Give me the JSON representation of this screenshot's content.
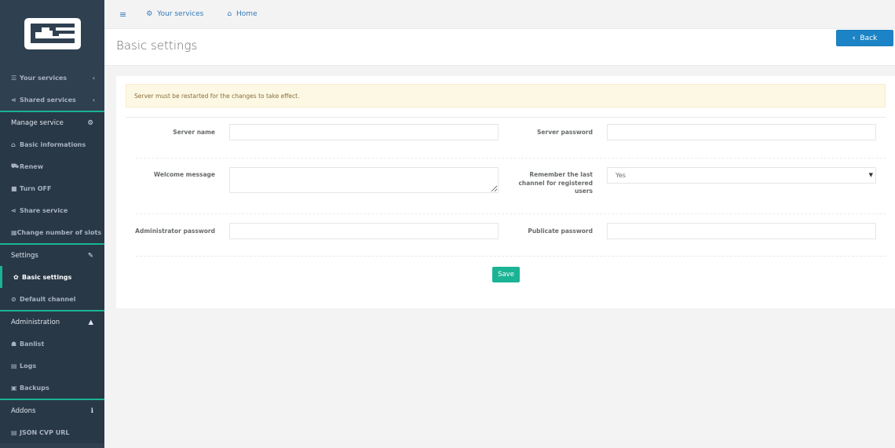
{
  "sidebar": {
    "logo": "logo",
    "items": [
      {
        "icon": "list-icon",
        "label": "Your services",
        "arrow": "‹"
      },
      {
        "icon": "share-icon",
        "label": "Shared services",
        "arrow": "‹"
      }
    ],
    "manage": {
      "title": "Manage service",
      "icon": "cogs-icon",
      "items": [
        {
          "icon": "home-icon",
          "label": "Basic informations"
        },
        {
          "icon": "cart-icon",
          "label": "Renew"
        },
        {
          "icon": "stop-icon",
          "label": "Turn OFF"
        },
        {
          "icon": "share-icon",
          "label": "Share service"
        },
        {
          "icon": "grid-icon",
          "label": "Change number of slots"
        }
      ]
    },
    "settings": {
      "title": "Settings",
      "icon": "wrench-icon",
      "items": [
        {
          "icon": "gear-icon",
          "label": "Basic settings",
          "active": true
        },
        {
          "icon": "circle-check-icon",
          "label": "Default channel"
        }
      ]
    },
    "administration": {
      "title": "Administration",
      "icon": "warning-icon",
      "items": [
        {
          "icon": "user-ban-icon",
          "label": "Banlist"
        },
        {
          "icon": "file-icon",
          "label": "Logs"
        },
        {
          "icon": "floppy-icon",
          "label": "Backups"
        }
      ]
    },
    "addons": {
      "title": "Addons",
      "icon": "info-icon",
      "items": [
        {
          "icon": "file-icon",
          "label": "JSON CVP URL"
        }
      ]
    }
  },
  "topbar": {
    "menu_icon": "hamburger-icon",
    "your_services": "Your services",
    "home": "Home"
  },
  "header": {
    "title": "Basic settings",
    "back": "Back"
  },
  "form": {
    "alert": "Server must be restarted for the changes to take effect.",
    "server_name_label": "Server name",
    "server_name_value": "",
    "server_password_label": "Server password",
    "server_password_value": "",
    "welcome_label": "Welcome message",
    "welcome_value": "",
    "remember_label": "Remember the last channel for registered users",
    "remember_value": "Yes",
    "admin_password_label": "Administrator password",
    "admin_password_value": "",
    "publicate_password_label": "Publicate password",
    "publicate_password_value": "",
    "save": "Save"
  },
  "colors": {
    "sidebar": "#2f4050",
    "accent": "#1ab394",
    "primary": "#1c84c6",
    "alert_bg": "#fcf8e3"
  }
}
